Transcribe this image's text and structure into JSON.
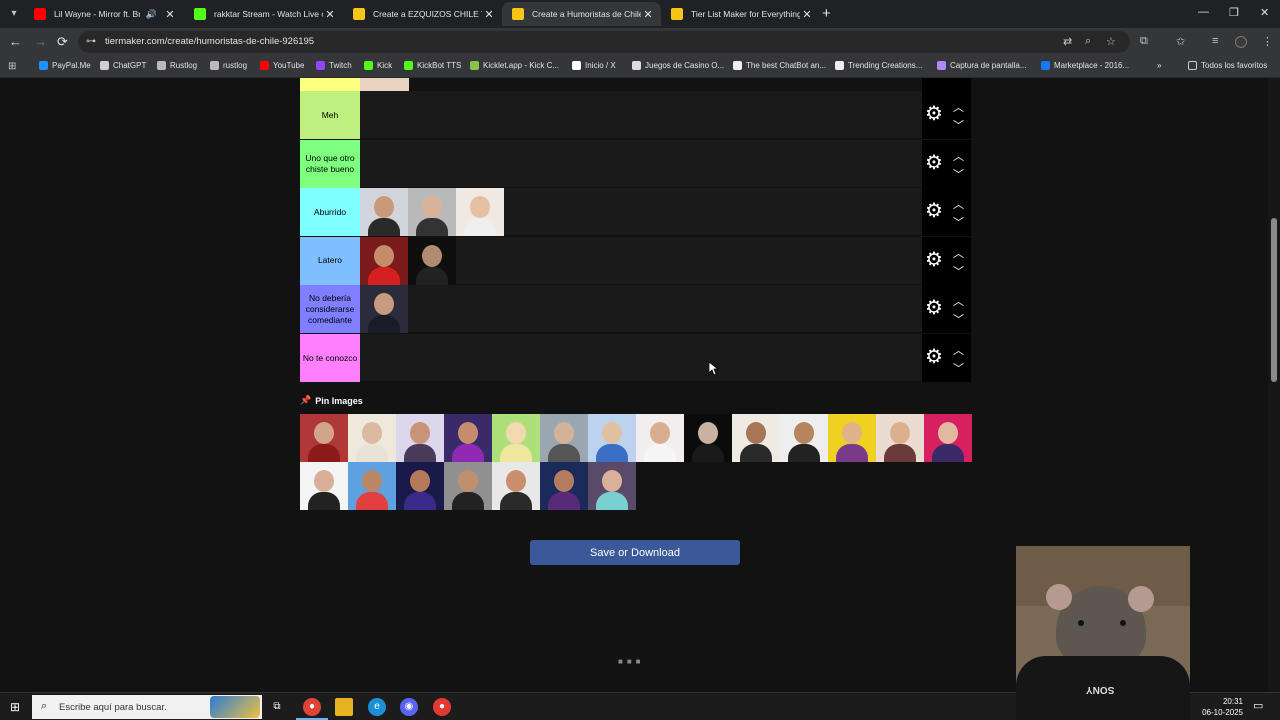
{
  "browser": {
    "tabs": [
      {
        "title": "Lil Wayne - Mirror ft. Bruno Mars",
        "favicon_color": "#ff0000",
        "audio": true
      },
      {
        "title": "rakktar Stream - Watch Live on Kick",
        "favicon_color": "#53fc18",
        "audio": false
      },
      {
        "title": "Create a EZQUIZOS CHILE Tier List",
        "favicon_color": "#f5c518",
        "audio": false
      },
      {
        "title": "Create a Humoristas de Chile Tier List",
        "favicon_color": "#f5c518",
        "audio": false
      },
      {
        "title": "Tier List Maker for Everything - TierMaker",
        "favicon_color": "#f5c518",
        "audio": false
      }
    ],
    "active_tab_index": 3,
    "url": "tiermaker.com/create/humoristas-de-chile-926195",
    "bookmarks": [
      {
        "label": "PayPal.Me",
        "color": "#1e90ff"
      },
      {
        "label": "ChatGPT",
        "color": "#cfcfcf"
      },
      {
        "label": "Rustlog",
        "color": "#bbbbbb"
      },
      {
        "label": "rustlog",
        "color": "#bbbbbb"
      },
      {
        "label": "YouTube",
        "color": "#ff0000"
      },
      {
        "label": "Twitch",
        "color": "#9146ff"
      },
      {
        "label": "Kick",
        "color": "#53fc18"
      },
      {
        "label": "KickBot TTS",
        "color": "#53fc18"
      },
      {
        "label": "Kicklet.app - Kick C...",
        "color": "#8bc34a"
      },
      {
        "label": "Inicio / X",
        "color": "#ffffff"
      },
      {
        "label": "Juegos de Casino O...",
        "color": "#dddddd"
      },
      {
        "label": "The best ChatBot an...",
        "color": "#eeeeee"
      },
      {
        "label": "Trending Creations...",
        "color": "#eeeeee"
      },
      {
        "label": "Captura de pantalla...",
        "color": "#b388ff"
      },
      {
        "label": "Marketplace - 2016...",
        "color": "#1877f2"
      }
    ],
    "all_bookmarks_label": "Todos los favoritos"
  },
  "tiers": [
    {
      "label": "Meh",
      "color": "#bff07f",
      "items": []
    },
    {
      "label": "Uno que otro chiste bueno",
      "color": "#7fff7f",
      "items": []
    },
    {
      "label": "Aburrido",
      "color": "#7fffff",
      "items": [
        {
          "skin": "#c99a7a",
          "shirt": "#2a2a2a",
          "bg": "#cfd5da"
        },
        {
          "skin": "#d8b39a",
          "shirt": "#333333",
          "bg": "#b9b9b9"
        },
        {
          "skin": "#e5c0a2",
          "shirt": "#eeeeee",
          "bg": "#efe9e2"
        }
      ]
    },
    {
      "label": "Latero",
      "color": "#7fbfff",
      "items": [
        {
          "skin": "#c58d6c",
          "shirt": "#d62020",
          "bg": "#7a1a1a"
        },
        {
          "skin": "#b38a72",
          "shirt": "#222222",
          "bg": "#0e0e0e"
        }
      ]
    },
    {
      "label": "No debería considerarse comediante",
      "color": "#7f7fff",
      "items": [
        {
          "skin": "#c79b80",
          "shirt": "#1b1b2a",
          "bg": "#2b2b3c"
        }
      ]
    },
    {
      "label": "No te conozco",
      "color": "#ff7fff",
      "items": []
    }
  ],
  "pool": {
    "label": "Pin Images",
    "items": [
      {
        "skin": "#d2a48a",
        "shirt": "#8b1a1a",
        "bg": "#b03838"
      },
      {
        "skin": "#dcb9a0",
        "shirt": "#e9e2d6",
        "bg": "#efe8dd"
      },
      {
        "skin": "#c89376",
        "shirt": "#4a3a5a",
        "bg": "#ddd7ee"
      },
      {
        "skin": "#c58d6c",
        "shirt": "#8e2bb2",
        "bg": "#3a2a6a"
      },
      {
        "skin": "#f2d9b0",
        "shirt": "#f0e6a0",
        "bg": "#aee07a"
      },
      {
        "skin": "#d2b39a",
        "shirt": "#555555",
        "bg": "#9aa6b0"
      },
      {
        "skin": "#e0c0a0",
        "shirt": "#3b6fc6",
        "bg": "#bcd3f0"
      },
      {
        "skin": "#d9ae8e",
        "shirt": "#f5f5f5",
        "bg": "#f2eeee"
      },
      {
        "skin": "#c9b3a0",
        "shirt": "#1a1a1a",
        "bg": "#0b0b0b"
      },
      {
        "skin": "#a87656",
        "shirt": "#2a2a2a",
        "bg": "#efeae2"
      },
      {
        "skin": "#b8845e",
        "shirt": "#222222",
        "bg": "#eeeeee"
      },
      {
        "skin": "#e0b28a",
        "shirt": "#7a3a8a",
        "bg": "#f0d020"
      },
      {
        "skin": "#dbb08e",
        "shirt": "#6a3a3a",
        "bg": "#eadcd0"
      },
      {
        "skin": "#e2b8a0",
        "shirt": "#3a2a6a",
        "bg": "#d62060"
      },
      {
        "skin": "#d8b09a",
        "shirt": "#222222",
        "bg": "#f5f5f5"
      },
      {
        "skin": "#b98768",
        "shirt": "#e24040",
        "bg": "#5ea0e0"
      },
      {
        "skin": "#b57b58",
        "shirt": "#3a2a8a",
        "bg": "#1a1a4a"
      },
      {
        "skin": "#c0906e",
        "shirt": "#222222",
        "bg": "#909090"
      },
      {
        "skin": "#c98f6c",
        "shirt": "#2a2a2a",
        "bg": "#e8e8e8"
      },
      {
        "skin": "#b57d60",
        "shirt": "#5a2a7a",
        "bg": "#1a2a5a"
      },
      {
        "skin": "#d9b09a",
        "shirt": "#7ad0d0",
        "bg": "#5a4a6a"
      }
    ]
  },
  "save_button_label": "Save or Download",
  "taskbar": {
    "search_placeholder": "Escribe aquí para buscar.",
    "time": "20:31",
    "date": "06-10-2025"
  },
  "webcam": {
    "brand": "SONY"
  }
}
